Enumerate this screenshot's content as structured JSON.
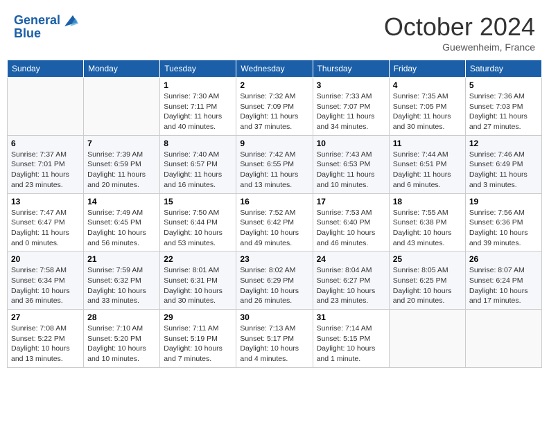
{
  "header": {
    "logo_line1": "General",
    "logo_line2": "Blue",
    "month_title": "October 2024",
    "location": "Guewenheim, France"
  },
  "weekdays": [
    "Sunday",
    "Monday",
    "Tuesday",
    "Wednesday",
    "Thursday",
    "Friday",
    "Saturday"
  ],
  "weeks": [
    [
      {
        "day": "",
        "info": ""
      },
      {
        "day": "",
        "info": ""
      },
      {
        "day": "1",
        "info": "Sunrise: 7:30 AM\nSunset: 7:11 PM\nDaylight: 11 hours and 40 minutes."
      },
      {
        "day": "2",
        "info": "Sunrise: 7:32 AM\nSunset: 7:09 PM\nDaylight: 11 hours and 37 minutes."
      },
      {
        "day": "3",
        "info": "Sunrise: 7:33 AM\nSunset: 7:07 PM\nDaylight: 11 hours and 34 minutes."
      },
      {
        "day": "4",
        "info": "Sunrise: 7:35 AM\nSunset: 7:05 PM\nDaylight: 11 hours and 30 minutes."
      },
      {
        "day": "5",
        "info": "Sunrise: 7:36 AM\nSunset: 7:03 PM\nDaylight: 11 hours and 27 minutes."
      }
    ],
    [
      {
        "day": "6",
        "info": "Sunrise: 7:37 AM\nSunset: 7:01 PM\nDaylight: 11 hours and 23 minutes."
      },
      {
        "day": "7",
        "info": "Sunrise: 7:39 AM\nSunset: 6:59 PM\nDaylight: 11 hours and 20 minutes."
      },
      {
        "day": "8",
        "info": "Sunrise: 7:40 AM\nSunset: 6:57 PM\nDaylight: 11 hours and 16 minutes."
      },
      {
        "day": "9",
        "info": "Sunrise: 7:42 AM\nSunset: 6:55 PM\nDaylight: 11 hours and 13 minutes."
      },
      {
        "day": "10",
        "info": "Sunrise: 7:43 AM\nSunset: 6:53 PM\nDaylight: 11 hours and 10 minutes."
      },
      {
        "day": "11",
        "info": "Sunrise: 7:44 AM\nSunset: 6:51 PM\nDaylight: 11 hours and 6 minutes."
      },
      {
        "day": "12",
        "info": "Sunrise: 7:46 AM\nSunset: 6:49 PM\nDaylight: 11 hours and 3 minutes."
      }
    ],
    [
      {
        "day": "13",
        "info": "Sunrise: 7:47 AM\nSunset: 6:47 PM\nDaylight: 11 hours and 0 minutes."
      },
      {
        "day": "14",
        "info": "Sunrise: 7:49 AM\nSunset: 6:45 PM\nDaylight: 10 hours and 56 minutes."
      },
      {
        "day": "15",
        "info": "Sunrise: 7:50 AM\nSunset: 6:44 PM\nDaylight: 10 hours and 53 minutes."
      },
      {
        "day": "16",
        "info": "Sunrise: 7:52 AM\nSunset: 6:42 PM\nDaylight: 10 hours and 49 minutes."
      },
      {
        "day": "17",
        "info": "Sunrise: 7:53 AM\nSunset: 6:40 PM\nDaylight: 10 hours and 46 minutes."
      },
      {
        "day": "18",
        "info": "Sunrise: 7:55 AM\nSunset: 6:38 PM\nDaylight: 10 hours and 43 minutes."
      },
      {
        "day": "19",
        "info": "Sunrise: 7:56 AM\nSunset: 6:36 PM\nDaylight: 10 hours and 39 minutes."
      }
    ],
    [
      {
        "day": "20",
        "info": "Sunrise: 7:58 AM\nSunset: 6:34 PM\nDaylight: 10 hours and 36 minutes."
      },
      {
        "day": "21",
        "info": "Sunrise: 7:59 AM\nSunset: 6:32 PM\nDaylight: 10 hours and 33 minutes."
      },
      {
        "day": "22",
        "info": "Sunrise: 8:01 AM\nSunset: 6:31 PM\nDaylight: 10 hours and 30 minutes."
      },
      {
        "day": "23",
        "info": "Sunrise: 8:02 AM\nSunset: 6:29 PM\nDaylight: 10 hours and 26 minutes."
      },
      {
        "day": "24",
        "info": "Sunrise: 8:04 AM\nSunset: 6:27 PM\nDaylight: 10 hours and 23 minutes."
      },
      {
        "day": "25",
        "info": "Sunrise: 8:05 AM\nSunset: 6:25 PM\nDaylight: 10 hours and 20 minutes."
      },
      {
        "day": "26",
        "info": "Sunrise: 8:07 AM\nSunset: 6:24 PM\nDaylight: 10 hours and 17 minutes."
      }
    ],
    [
      {
        "day": "27",
        "info": "Sunrise: 7:08 AM\nSunset: 5:22 PM\nDaylight: 10 hours and 13 minutes."
      },
      {
        "day": "28",
        "info": "Sunrise: 7:10 AM\nSunset: 5:20 PM\nDaylight: 10 hours and 10 minutes."
      },
      {
        "day": "29",
        "info": "Sunrise: 7:11 AM\nSunset: 5:19 PM\nDaylight: 10 hours and 7 minutes."
      },
      {
        "day": "30",
        "info": "Sunrise: 7:13 AM\nSunset: 5:17 PM\nDaylight: 10 hours and 4 minutes."
      },
      {
        "day": "31",
        "info": "Sunrise: 7:14 AM\nSunset: 5:15 PM\nDaylight: 10 hours and 1 minute."
      },
      {
        "day": "",
        "info": ""
      },
      {
        "day": "",
        "info": ""
      }
    ]
  ]
}
